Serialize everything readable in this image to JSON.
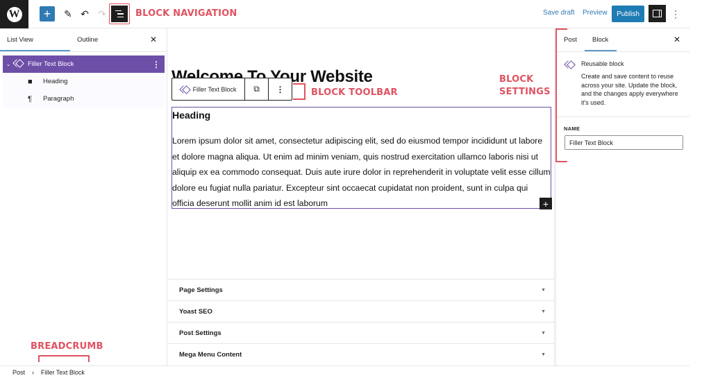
{
  "topbar": {
    "logo": "W",
    "add_icon": "+",
    "tools_icon": "✎",
    "undo_icon": "↶",
    "redo_icon": "↷",
    "save_draft": "Save draft",
    "preview": "Preview",
    "publish": "Publish",
    "more_icon": "⋮"
  },
  "annotations": {
    "block_navigation": "BLOCK NAVIGATION",
    "block_toolbar": "BLOCK TOOLBAR",
    "block_settings_line1": "BLOCK",
    "block_settings_line2": "SETTINGS",
    "breadcrumb": "BREADCRUMB"
  },
  "left_sidebar": {
    "tabs": [
      {
        "label": "List View",
        "active": true
      },
      {
        "label": "Outline",
        "active": false
      }
    ],
    "close_icon": "✕",
    "tree": {
      "selected": {
        "label": "Filler Text Block",
        "chevron": "⌄",
        "more": "⋮"
      },
      "children": [
        {
          "label": "Heading",
          "icon": "🔖"
        },
        {
          "label": "Paragraph",
          "icon": "¶"
        }
      ]
    }
  },
  "canvas": {
    "page_title": "Welcome To Your Website",
    "block_toolbar": {
      "block_name": "Filler Text Block",
      "copy_icon": "⧉",
      "more_icon": "⋮"
    },
    "heading": "Heading",
    "paragraph": "Lorem ipsum dolor sit amet, consectetur adipiscing elit, sed do eiusmod tempor incididunt ut labore et dolore magna aliqua. Ut enim ad minim veniam, quis nostrud exercitation ullamco laboris nisi ut aliquip ex ea commodo consequat. Duis aute irure dolor in reprehenderit in voluptate velit esse cillum dolore eu fugiat nulla pariatur. Excepteur sint occaecat cupidatat non proident, sunt in culpa qui officia deserunt mollit anim id est laborum",
    "inserter_icon": "+"
  },
  "metaboxes": [
    {
      "label": "Page Settings"
    },
    {
      "label": "Yoast SEO"
    },
    {
      "label": "Post Settings"
    },
    {
      "label": "Mega Menu Content"
    }
  ],
  "metabox_toggle_icon": "▼",
  "right_sidebar": {
    "tabs": [
      {
        "label": "Post",
        "active": false
      },
      {
        "label": "Block",
        "active": true
      }
    ],
    "close_icon": "✕",
    "card_title": "Reusable block",
    "card_description": "Create and save content to reuse across your site. Update the block, and the changes apply everywhere it's used.",
    "name_label": "NAME",
    "name_value": "Filler Text Block"
  },
  "breadcrumb": {
    "items": [
      "Post",
      "Filler Text Block"
    ],
    "separator": "›"
  },
  "colors": {
    "accent_blue": "#2f7ab3",
    "block_purple": "#6d4fa8",
    "annotation_red": "#e05260",
    "dark": "#1e1e1e"
  }
}
